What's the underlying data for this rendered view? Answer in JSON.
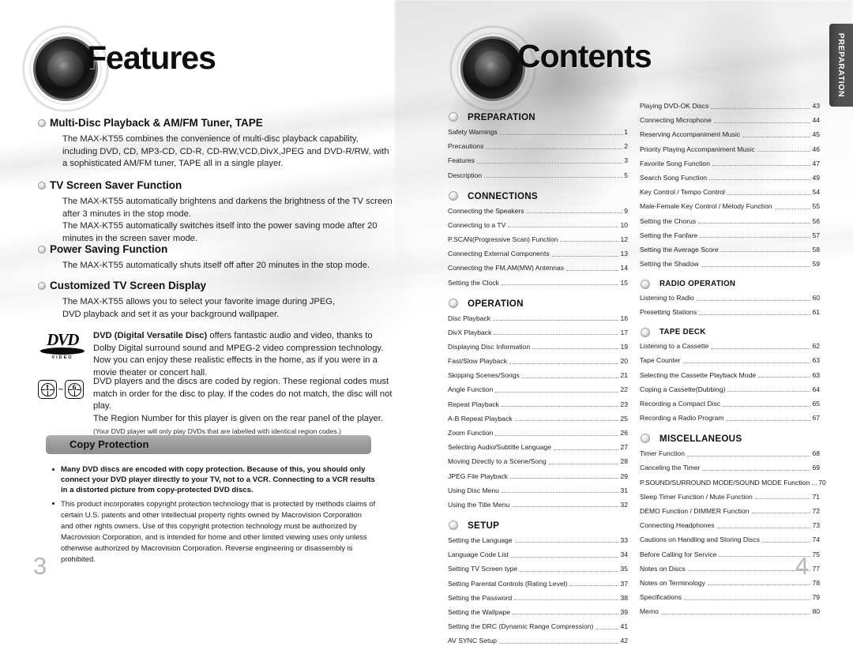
{
  "left_page": {
    "title": "Features",
    "folio": "3",
    "features": [
      {
        "heading": "Multi-Disc Playback & AM/FM Tuner,  TAPE",
        "body": "The MAX-KT55 combines the convenience of multi-disc playback capability, including DVD, CD, MP3-CD, CD-R, CD-RW,VCD,DivX,JPEG and DVD-R/RW, with a sophisticated AM/FM tuner, TAPE all in a single player."
      },
      {
        "heading": "TV Screen Saver Function",
        "body": "The MAX-KT55 automatically brightens and darkens the brightness of the TV screen after 3 minutes in the stop mode.\nThe MAX-KT55 automatically switches itself into the power saving mode after 20 minutes in the screen saver mode."
      },
      {
        "heading": "Power Saving Function",
        "body": "The MAX-KT55 automatically shuts itself off after 20 minutes in the stop  mode."
      },
      {
        "heading": "Customized TV Screen Display",
        "body": "The MAX-KT55 allows you to select your favorite image during JPEG,\nDVD playback and set it as your background wallpaper."
      }
    ],
    "dvd_logo": {
      "wordmark": "DVD",
      "sublabel": "VIDEO"
    },
    "dvd_paragraph_bold": "DVD (Digital Versatile Disc)",
    "dvd_paragraph_rest": " offers fantastic audio and video, thanks to Dolby Digital surround sound and MPEG-2 video compression technology. Now you can enjoy these realistic effects in the home, as if you were in a movie theater or concert hall.",
    "region_icons": {
      "first": "1",
      "separator": "~",
      "last": "6"
    },
    "region_paragraph": "DVD players and the discs are coded by region. These regional codes must match in order for the disc to play. If the codes do not match, the disc will not play.\nThe Region Number for this player is given on the rear panel of the player.",
    "region_note": "(Your DVD player will only play DVDs that are labelled with identical region codes.)",
    "copy_protection": {
      "title": "Copy Protection",
      "items": [
        {
          "bold": true,
          "text": "Many DVD discs are encoded with copy protection. Because of this, you should only connect your DVD player directly to your TV, not to a VCR. Connecting to a VCR results in a distorted picture from copy-protected DVD discs."
        },
        {
          "bold": false,
          "text": "This product incorporates copyright protection technology that is protected by methods claims of certain U.S. patents and other intellectual property rights owned by Macrovision Corporation and other rights owners. Use of this copyright protection technology must be authorized by Macrovision Corporation, and is intended for home and other limited viewing uses only unless otherwise authorized by Macrovision Corporation. Reverse engineering or disassembly is prohibited."
        }
      ]
    }
  },
  "right_page": {
    "title": "Contents",
    "folio": "4",
    "side_tab": "PREPARATION",
    "columns": [
      {
        "sections": [
          {
            "name": "PREPARATION",
            "style": "large",
            "entries": [
              {
                "title": "Safety Warnings",
                "page": "1"
              },
              {
                "title": "Precautions",
                "page": "2"
              },
              {
                "title": "Features",
                "page": "3"
              },
              {
                "title": "Description",
                "page": "5"
              }
            ]
          },
          {
            "name": "CONNECTIONS",
            "style": "large",
            "entries": [
              {
                "title": "Connecting the Speakers",
                "page": "9"
              },
              {
                "title": "Connecting to a TV",
                "page": "10"
              },
              {
                "title": "P.SCAN(Progressive Scan) Function",
                "page": "12"
              },
              {
                "title": "Connecting External Components",
                "page": "13"
              },
              {
                "title": "Connecting the FM,AM(MW) Antennas",
                "page": "14"
              },
              {
                "title": "Setting the Clock",
                "page": "15"
              }
            ]
          },
          {
            "name": "OPERATION",
            "style": "large",
            "entries": [
              {
                "title": "Disc Playback",
                "page": "16"
              },
              {
                "title": "DivX Playback",
                "page": "17"
              },
              {
                "title": "Displaying Disc Information",
                "page": "19"
              },
              {
                "title": "Fast/Slow Playback",
                "page": "20"
              },
              {
                "title": "Skipping Scenes/Songs",
                "page": "21"
              },
              {
                "title": "Angle Function",
                "page": "22"
              },
              {
                "title": "Repeat Playback",
                "page": "23"
              },
              {
                "title": "A-B  Repeat Playback",
                "page": "25"
              },
              {
                "title": "Zoom Function",
                "page": "26"
              },
              {
                "title": "Selecting Audio/Subtitle Language",
                "page": "27"
              },
              {
                "title": "Moving Directly to a Scene/Song",
                "page": "28"
              },
              {
                "title": "JPEG File Playback",
                "page": "29"
              },
              {
                "title": "Using Disc Menu",
                "page": "31"
              },
              {
                "title": "Using the Title Menu",
                "page": "32"
              }
            ]
          },
          {
            "name": "SETUP",
            "style": "large",
            "entries": [
              {
                "title": "Setting the Language",
                "page": "33"
              },
              {
                "title": "Language Code List",
                "page": "34"
              },
              {
                "title": "Setting TV Screen type",
                "page": "35"
              },
              {
                "title": "Setting Parental Controls (Rating Level)",
                "page": "37"
              },
              {
                "title": "Setting the Password",
                "page": "38"
              },
              {
                "title": "Setting the Wallpape",
                "page": "39"
              },
              {
                "title": "Setting the DRC (Dynamic Range Compression)",
                "page": "41"
              },
              {
                "title": "AV SYNC Setup",
                "page": "42"
              }
            ]
          }
        ]
      },
      {
        "sections": [
          {
            "name": "",
            "style": "none",
            "entries": [
              {
                "title": "Playing DVD-OK Discs",
                "page": "43"
              },
              {
                "title": "Connecting Microphone",
                "page": "44"
              },
              {
                "title": "Reserving Accompaniment Music",
                "page": "45"
              },
              {
                "title": "Priority Playing Accompaniment Music",
                "page": "46"
              },
              {
                "title": "Favorite Song Function",
                "page": "47"
              },
              {
                "title": "Search Song Function",
                "page": "49"
              },
              {
                "title": "Key Control / Tempo Control",
                "page": "54"
              },
              {
                "title": "Male-Female Key Control / Melody Function",
                "page": "55"
              },
              {
                "title": "Setting the Chorus",
                "page": "56"
              },
              {
                "title": "Setting the Fanfare",
                "page": "57"
              },
              {
                "title": "Setting the Average Score",
                "page": "58"
              },
              {
                "title": "Setting the Shadow",
                "page": "59"
              }
            ]
          },
          {
            "name": "RADIO OPERATION",
            "style": "small",
            "entries": [
              {
                "title": "Listening to Radio",
                "page": "60"
              },
              {
                "title": "Presetting Stations",
                "page": "61"
              }
            ]
          },
          {
            "name": "TAPE DECK",
            "style": "small",
            "entries": [
              {
                "title": "Listening to a Cassette",
                "page": "62"
              },
              {
                "title": "Tape Counter",
                "page": "63"
              },
              {
                "title": "Selecting the Cassette Playback Mode",
                "page": "63"
              },
              {
                "title": "Coping a Cassette(Dubbing)",
                "page": "64"
              },
              {
                "title": "Recording a Compact Disc",
                "page": "65"
              },
              {
                "title": "Recording a Radio Program",
                "page": "67"
              }
            ]
          },
          {
            "name": "MISCELLANEOUS",
            "style": "large",
            "entries": [
              {
                "title": "Timer Function",
                "page": "68"
              },
              {
                "title": "Canceling the Timer",
                "page": "69"
              },
              {
                "title": "P.SOUND/SURROUND MODE/SOUND MODE Function",
                "page": "70"
              },
              {
                "title": "Sleep Timer Function / Mute Function",
                "page": "71"
              },
              {
                "title": "DEMO Function / DIMMER Function",
                "page": "72"
              },
              {
                "title": "Connecting Headphones",
                "page": "73"
              },
              {
                "title": "Cautions on Handling and Storing Discs",
                "page": "74"
              },
              {
                "title": "Before Calling for Service",
                "page": "75"
              },
              {
                "title": "Notes on Discs",
                "page": "77"
              },
              {
                "title": "Notes on Terminology",
                "page": "78"
              },
              {
                "title": "Specifications",
                "page": "79"
              },
              {
                "title": "Memo",
                "page": "80"
              }
            ]
          }
        ]
      }
    ]
  }
}
